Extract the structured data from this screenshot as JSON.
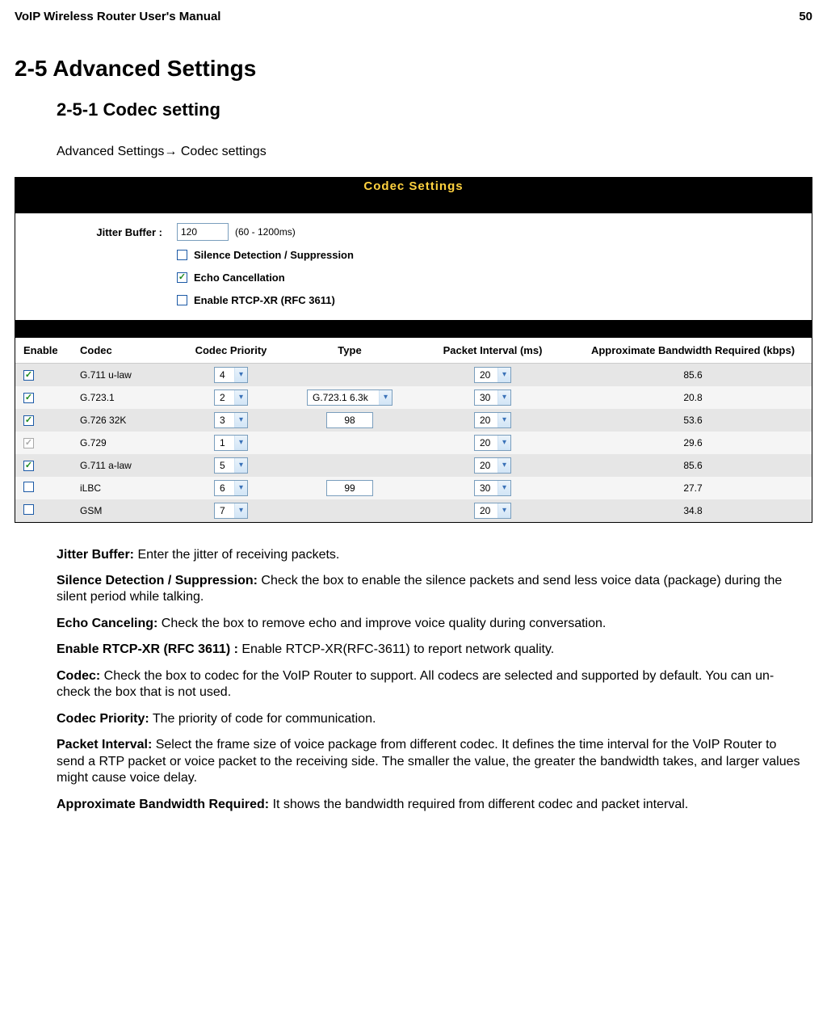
{
  "doc": {
    "header_left": "VoIP Wireless Router User's Manual",
    "header_right": "50"
  },
  "headings": {
    "h1": "2-5 Advanced Settings",
    "h2": "2-5-1 Codec setting"
  },
  "breadcrumb": {
    "text_a": "Advanced Settings",
    "arrow": "→",
    "text_b": " Codec settings"
  },
  "panel": {
    "title": "Codec Settings",
    "form": {
      "jitter_label": "Jitter Buffer :",
      "jitter_value": "120",
      "jitter_hint": "(60 - 1200ms)",
      "silence_label": "Silence Detection / Suppression",
      "silence_checked": false,
      "echo_label": "Echo Cancellation",
      "echo_checked": true,
      "rtcp_label": "Enable RTCP-XR (RFC 3611)",
      "rtcp_checked": false
    },
    "table": {
      "headers": {
        "enable": "Enable",
        "codec": "Codec",
        "priority": "Codec Priority",
        "type": "Type",
        "interval": "Packet Interval (ms)",
        "bandwidth": "Approximate Bandwidth Required (kbps)"
      },
      "rows": [
        {
          "enabled": true,
          "grey": false,
          "codec": "G.711 u-law",
          "priority": "4",
          "type_kind": "none",
          "type_value": "",
          "interval": "20",
          "bw": "85.6"
        },
        {
          "enabled": true,
          "grey": false,
          "codec": "G.723.1",
          "priority": "2",
          "type_kind": "select",
          "type_value": "G.723.1 6.3k",
          "interval": "30",
          "bw": "20.8"
        },
        {
          "enabled": true,
          "grey": false,
          "codec": "G.726 32K",
          "priority": "3",
          "type_kind": "input",
          "type_value": "98",
          "interval": "20",
          "bw": "53.6"
        },
        {
          "enabled": true,
          "grey": true,
          "codec": "G.729",
          "priority": "1",
          "type_kind": "none",
          "type_value": "",
          "interval": "20",
          "bw": "29.6"
        },
        {
          "enabled": true,
          "grey": false,
          "codec": "G.711 a-law",
          "priority": "5",
          "type_kind": "none",
          "type_value": "",
          "interval": "20",
          "bw": "85.6"
        },
        {
          "enabled": false,
          "grey": false,
          "codec": "iLBC",
          "priority": "6",
          "type_kind": "input",
          "type_value": "99",
          "interval": "30",
          "bw": "27.7"
        },
        {
          "enabled": false,
          "grey": false,
          "codec": "GSM",
          "priority": "7",
          "type_kind": "none",
          "type_value": "",
          "interval": "20",
          "bw": "34.8"
        }
      ]
    }
  },
  "descriptions": {
    "jitter_b": "Jitter Buffer:",
    "jitter_t": " Enter the jitter of receiving packets.",
    "silence_b": "Silence Detection / Suppression:",
    "silence_t": " Check the box to enable the silence packets and send less voice data (package) during the silent period while talking.",
    "echo_b": "Echo Canceling:",
    "echo_t": " Check the box to remove echo and improve voice quality during conversation.",
    "rtcp_b": "Enable RTCP-XR (RFC 3611) :",
    "rtcp_t": " Enable RTCP-XR(RFC-3611) to report network quality.",
    "codec_b": "Codec:",
    "codec_t": " Check the box to codec for the VoIP Router to support. All codecs are selected and supported by default. You can un-check the box that is not used.",
    "priority_b": "Codec Priority:",
    "priority_t": " The priority of code for communication.",
    "interval_b": "Packet Interval:",
    "interval_t": " Select the frame size of voice package from different codec. It defines the time interval for the VoIP Router to send a RTP packet or voice packet to the receiving side. The smaller the value, the greater the bandwidth takes, and larger values might cause voice delay.",
    "bw_b": "Approximate Bandwidth Required:",
    "bw_t": " It shows the bandwidth required from different codec and packet interval."
  }
}
